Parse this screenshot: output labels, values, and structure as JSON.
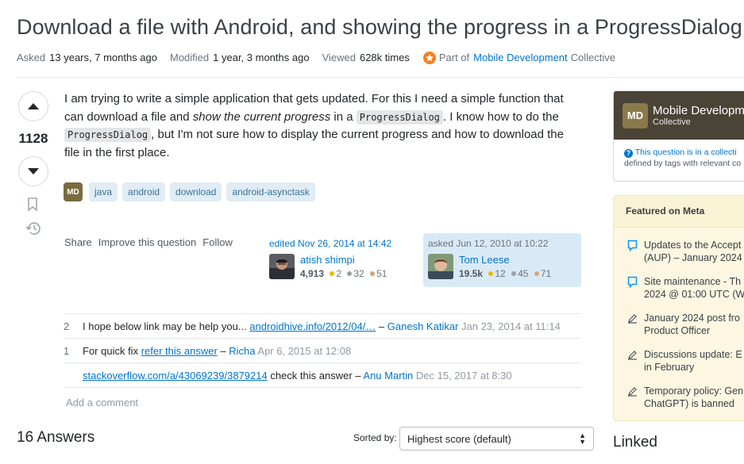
{
  "question": {
    "title": "Download a file with Android, and showing the progress in a ProgressDialog",
    "meta": {
      "asked_label": "Asked",
      "asked_value": "13 years, 7 months ago",
      "modified_label": "Modified",
      "modified_value": "1 year, 3 months ago",
      "viewed_label": "Viewed",
      "viewed_value": "628k times",
      "collective_prefix": "Part of",
      "collective_name": "Mobile Development",
      "collective_suffix": "Collective"
    },
    "votes": "1128",
    "body": {
      "t1": "I am trying to write a simple application that gets updated. For this I need a simple function that can download a file and ",
      "em1": "show the current progress",
      "t2": " in a ",
      "code1": "ProgressDialog",
      "t3": ". I know how to do the ",
      "code2": "ProgressDialog",
      "t4": ", but I'm not sure how to display the current progress and how to download the file in the first place."
    },
    "collective_badge": "MD",
    "tags": [
      "java",
      "android",
      "download",
      "android-asynctask"
    ],
    "actions": {
      "share": "Share",
      "improve": "Improve this question",
      "follow": "Follow"
    },
    "edited": {
      "label": "edited Nov 26, 2014 at 14:42",
      "user": "atish shimpi",
      "rep": "4,913",
      "gold": "2",
      "silver": "32",
      "bronze": "51"
    },
    "asked": {
      "label": "asked Jun 12, 2010 at 10:22",
      "user": "Tom Leese",
      "rep": "19.5k",
      "gold": "12",
      "silver": "45",
      "bronze": "71"
    }
  },
  "comments": [
    {
      "score": "2",
      "text": "I hope below link may be help you... ",
      "link": "androidhive.info/2012/04/…",
      "sep": " – ",
      "user": "Ganesh Katikar",
      "date": " Jan 23, 2014 at 11:14"
    },
    {
      "score": "1",
      "text": "For quick fix ",
      "link": "refer this answer",
      "sep": " – ",
      "user": "Richa",
      "date": " Apr 6, 2015 at 12:08"
    },
    {
      "score": "",
      "text": "",
      "link": "stackoverflow.com/a/43069239/3879214",
      "after": " check this answer",
      "sep": " – ",
      "user": "Anu Martin",
      "date": " Dec 15, 2017 at 8:30"
    }
  ],
  "add_comment": "Add a comment",
  "answers": {
    "count": "16 Answers",
    "sort_label": "Sorted by:",
    "sort_value": "Highest score (default)"
  },
  "sidebar": {
    "collective": {
      "badge": "MD",
      "name": "Mobile Developm",
      "sub": "Collective",
      "note_link": "This question is in a collecti",
      "note_text": "defined by tags with relevant co"
    },
    "featured_meta": {
      "title": "Featured on Meta",
      "items": [
        {
          "line1": "Updates to the Accept",
          "line2": "(AUP) – January 2024",
          "icon": "speech-bubble-icon"
        },
        {
          "line1": "Site maintenance - Th",
          "line2": "2024 @ 01:00 UTC (W",
          "icon": "speech-bubble-icon"
        },
        {
          "line1": "January 2024 post fro",
          "line2": "Product Officer",
          "icon": "pencil-icon"
        },
        {
          "line1": "Discussions update: E",
          "line2": "in February",
          "icon": "pencil-icon"
        },
        {
          "line1": "Temporary policy: Gen",
          "line2": "ChatGPT) is banned",
          "icon": "pencil-icon"
        }
      ]
    },
    "linked_title": "Linked"
  },
  "colors": {
    "accent": "#0074cc",
    "tag_bg": "#e1ecf4",
    "tag_fg": "#39739d",
    "gold": "#f1b600",
    "silver": "#9a9fa6",
    "bronze": "#d1a684",
    "meta_bg": "#fdf7e2"
  }
}
